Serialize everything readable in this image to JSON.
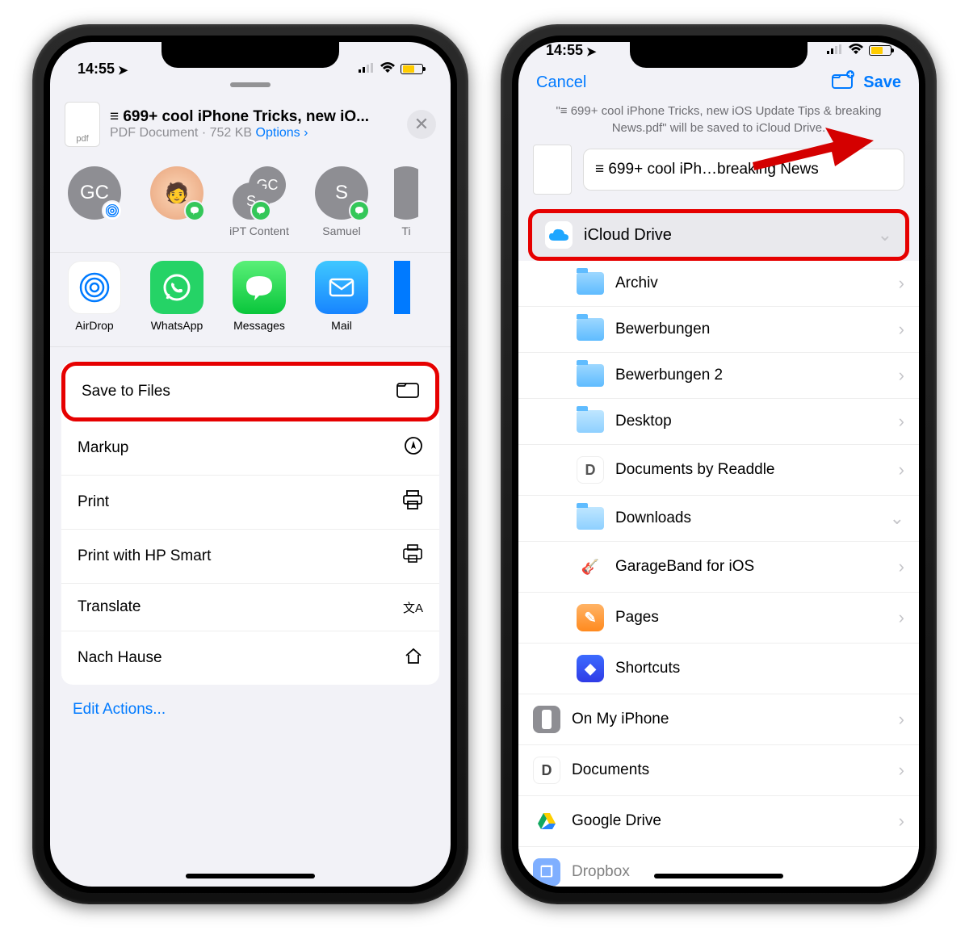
{
  "status": {
    "time": "14:55"
  },
  "left": {
    "share_title": "≡ 699+ cool iPhone Tricks, new iO...",
    "share_subtitle": "PDF Document · 752 KB",
    "options": "Options",
    "pdf_label": "pdf",
    "contacts": [
      {
        "initials": "GC",
        "label": ""
      },
      {
        "initials": "",
        "label": ""
      },
      {
        "initials": "GC",
        "initials2": "S",
        "label": "iPT Content"
      },
      {
        "initials": "S",
        "label": "Samuel"
      },
      {
        "initials": "",
        "label": "Ti"
      }
    ],
    "apps": {
      "airdrop": "AirDrop",
      "whatsapp": "WhatsApp",
      "messages": "Messages",
      "mail": "Mail"
    },
    "actions": {
      "save_to_files": "Save to Files",
      "markup": "Markup",
      "print": "Print",
      "print_hp": "Print with HP Smart",
      "translate": "Translate",
      "nach_hause": "Nach Hause"
    },
    "edit_actions": "Edit Actions..."
  },
  "right": {
    "cancel": "Cancel",
    "save": "Save",
    "message": "\"≡ 699+ cool iPhone Tricks, new iOS Update Tips & breaking  News.pdf\" will be saved to iCloud Drive.",
    "filename": "≡ 699+ cool iPh…breaking  News",
    "location_header": "iCloud Drive",
    "folders": [
      {
        "name": "Archiv",
        "type": "folder"
      },
      {
        "name": "Bewerbungen",
        "type": "folder"
      },
      {
        "name": "Bewerbungen 2",
        "type": "folder"
      },
      {
        "name": "Desktop",
        "type": "folder-light"
      },
      {
        "name": "Documents by Readdle",
        "type": "app",
        "icon": "D",
        "color": "#ffd400",
        "bg": "#fff"
      },
      {
        "name": "Downloads",
        "type": "folder-light",
        "chev": "down"
      },
      {
        "name": "GarageBand for iOS",
        "type": "app",
        "icon": "🎸",
        "bg": "#fff"
      },
      {
        "name": "Pages",
        "type": "app",
        "icon": "📄",
        "bg": "#ff9033"
      },
      {
        "name": "Shortcuts",
        "type": "app",
        "icon": "▢",
        "bg": "#3f6bff",
        "nochev": true
      }
    ],
    "root_locations": [
      {
        "name": "On My iPhone",
        "icon": "phone"
      },
      {
        "name": "Documents",
        "icon": "D"
      },
      {
        "name": "Google Drive",
        "icon": "drive"
      },
      {
        "name": "Dropbox",
        "icon": "dropbox"
      }
    ]
  }
}
